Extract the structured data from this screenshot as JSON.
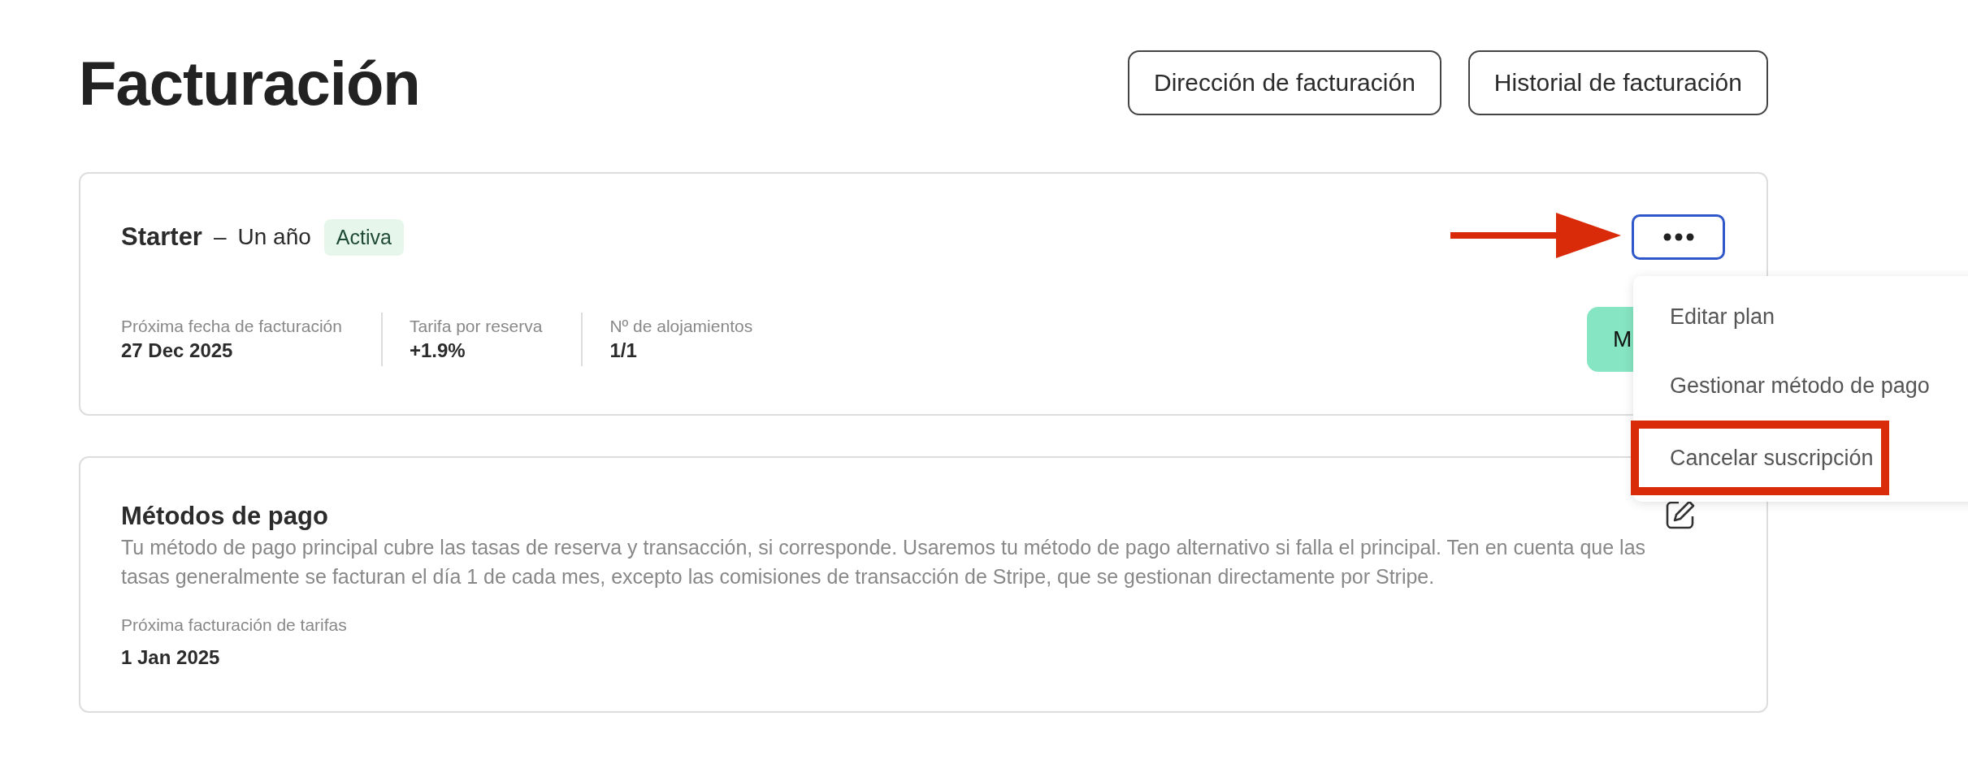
{
  "page": {
    "title": "Facturación",
    "buttons": [
      "Dirección de facturación",
      "Historial de facturación"
    ]
  },
  "plan": {
    "name": "Starter",
    "separator": "–",
    "term": "Un año",
    "status": "Activa",
    "menu_focused": true,
    "action_button": "M",
    "stats": [
      {
        "label": "Próxima fecha de facturación",
        "value": "27 Dec 2025"
      },
      {
        "label": "Tarifa por reserva",
        "value": "+1.9%"
      },
      {
        "label": "Nº de alojamientos",
        "value": "1/1"
      }
    ]
  },
  "menu": {
    "open": true,
    "items": [
      {
        "label": "Editar plan",
        "highlighted": false
      },
      {
        "label": "Gestionar método de pago",
        "highlighted": false
      },
      {
        "label": "Cancelar suscripción",
        "highlighted": true
      }
    ]
  },
  "payment_methods": {
    "title": "Métodos de pago",
    "description": "Tu método de pago principal cubre las tasas de reserva y transacción, si corresponde. Usaremos tu método de pago alternativo si falla el principal. Ten en cuenta que las tasas generalmente se facturan el día 1 de cada mes, excepto las comisiones de transacción de Stripe, que se gestionan directamente por Stripe.",
    "next_label": "Próxima facturación de tarifas",
    "next_value": "1 Jan 2025"
  }
}
